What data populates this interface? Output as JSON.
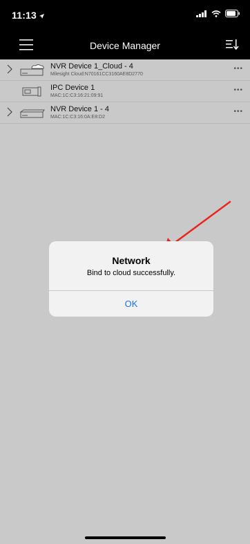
{
  "status_bar": {
    "time": "11:13"
  },
  "nav": {
    "title": "Device Manager"
  },
  "devices": [
    {
      "name": "NVR Device 1_Cloud - 4",
      "detail": "Milesight Cloud:N70161CC3160AE8D2770",
      "icon": "nvr-cloud-icon",
      "expandable": true
    },
    {
      "name": "IPC Device 1",
      "detail": "MAC:1C:C3:16:21:09:91",
      "icon": "camera-icon",
      "expandable": false
    },
    {
      "name": "NVR Device 1 - 4",
      "detail": "MAC:1C:C3:16:0A:E8:D2",
      "icon": "nvr-icon",
      "expandable": true
    }
  ],
  "more_label": "•••",
  "alert": {
    "title": "Network",
    "message": "Bind to cloud successfully.",
    "ok_label": "OK"
  },
  "colors": {
    "accent": "#1a73e8",
    "arrow": "#e8251f"
  }
}
